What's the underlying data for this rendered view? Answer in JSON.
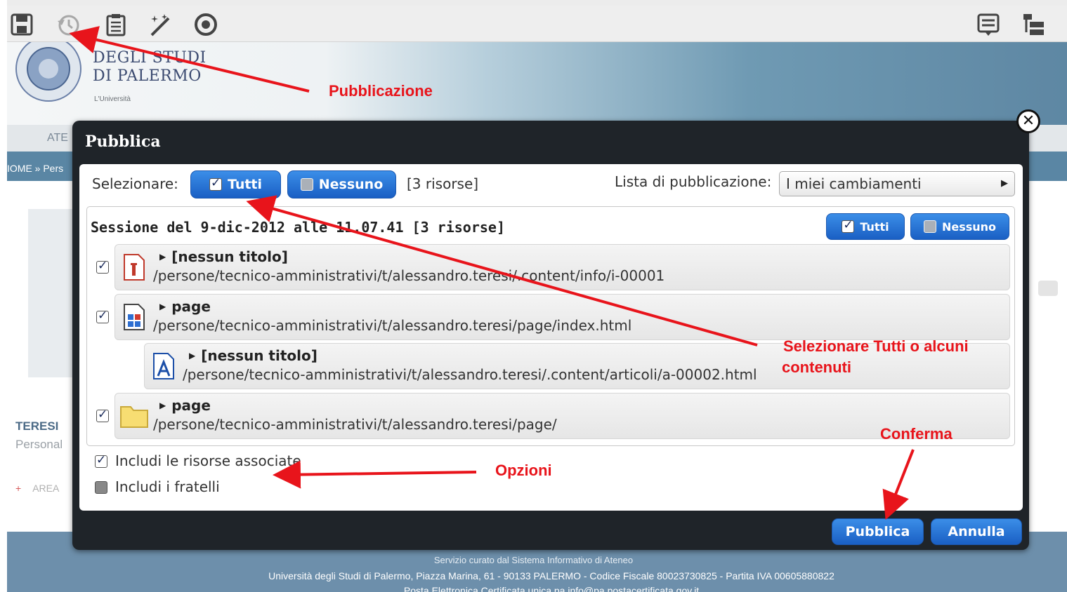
{
  "site": {
    "university_line1": "DEGLI STUDI",
    "university_line2": "DI PALERMO",
    "university_tag": "L'Università",
    "nav_partial": "ATE",
    "breadcrumb_partial": "IOME » Pers",
    "person_name_partial": "TERESI",
    "person_role_partial": "Personal",
    "area_link_partial": "AREA",
    "area_link_marker": "+",
    "footer_line1": "Servizio curato dal Sistema Informativo di Ateneo",
    "footer_line2": "Università  degli Studi di Palermo, Piazza Marina, 61 - 90133 PALERMO - Codice Fiscale 80023730825 - Partita IVA 00605880822",
    "footer_line3": "Posta Elettronica Certificata unica pa info@pa.postacertificata.gov.it"
  },
  "toolbar": {
    "icons": [
      "save-icon",
      "history-icon",
      "clipboard-icon",
      "magic-wand-icon",
      "publish-circle-icon",
      "list-view-icon",
      "tree-view-icon"
    ]
  },
  "dialog": {
    "title": "Pubblica",
    "close_icon": "close-icon",
    "select_label": "Selezionare:",
    "select_all": "Tutti",
    "select_none": "Nessuno",
    "resource_count": "[3 risorse]",
    "publish_list_label": "Lista di pubblicazione:",
    "publish_list_value": "I miei cambiamenti",
    "session": {
      "title": "Sessione del 9-dic-2012 alle 11.07.41  [3 risorse]",
      "select_all": "Tutti",
      "select_none": "Nessuno"
    },
    "resources": [
      {
        "title": "[nessun titolo]",
        "path": "/persone/tecnico-amministrativi/t/alessandro.teresi/.content/info/i-00001",
        "icon": "info-document-icon",
        "checked": true
      },
      {
        "title": "page",
        "path": "/persone/tecnico-amministrativi/t/alessandro.teresi/page/index.html",
        "icon": "page-document-icon",
        "checked": true
      },
      {
        "title": "[nessun titolo]",
        "path": "/persone/tecnico-amministrativi/t/alessandro.teresi/.content/articoli/a-00002.html",
        "icon": "article-document-icon",
        "checked": false
      },
      {
        "title": "page",
        "path": "/persone/tecnico-amministrativi/t/alessandro.teresi/page/",
        "icon": "folder-icon",
        "checked": true
      }
    ],
    "options": [
      {
        "label": "Includi le risorse associate",
        "checked": true
      },
      {
        "label": "Includi i fratelli",
        "checked": false
      }
    ],
    "publish_button": "Pubblica",
    "cancel_button": "Annulla"
  },
  "annotations": {
    "publication": "Pubblicazione",
    "select_all_or_some_1": "Selezionare Tutti o alcuni",
    "select_all_or_some_2": "contenuti",
    "confirm": "Conferma",
    "options": "Opzioni",
    "color": "#e8141b"
  }
}
